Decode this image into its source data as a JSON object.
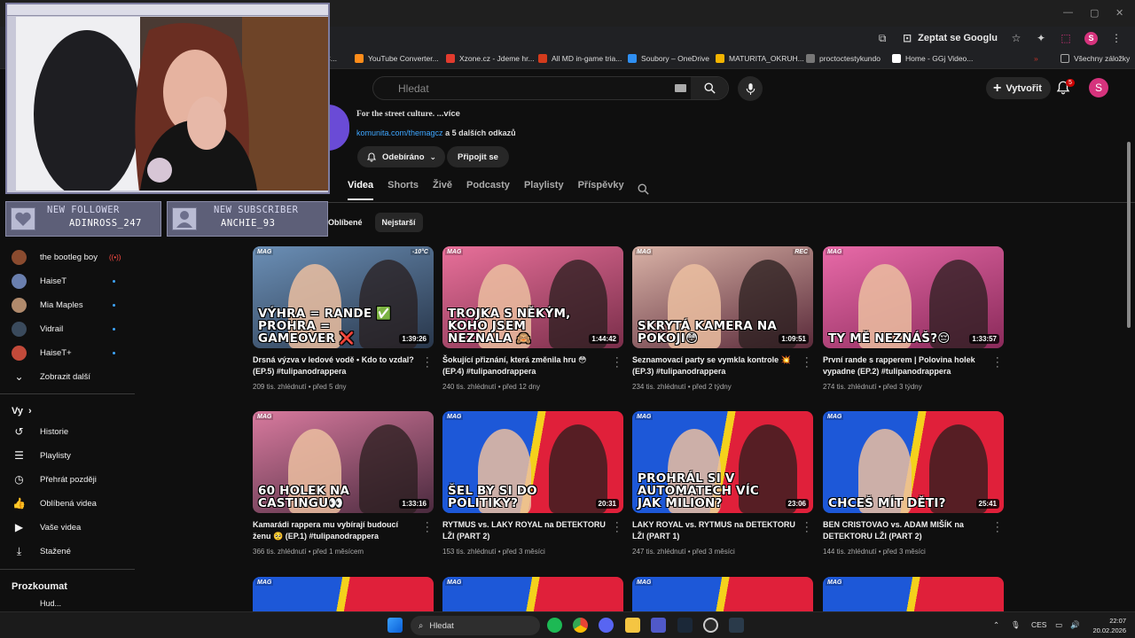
{
  "browser": {
    "ask_google_label": "Zeptat se Googlu",
    "profile_initial": "S",
    "bookmarks": [
      {
        "label": "dC...",
        "color": "#888888"
      },
      {
        "label": "YouTube Converter...",
        "color": "#ff8c1a"
      },
      {
        "label": "Xzone.cz - Jdeme hr...",
        "color": "#e23b2e"
      },
      {
        "label": "All MD in-game tria...",
        "color": "#d33b1c"
      },
      {
        "label": "Soubory – OneDrive",
        "color": "#2f8ff2"
      },
      {
        "label": "MATURITA_OKRUH...",
        "color": "#f4b400"
      },
      {
        "label": "proctoctestykundo",
        "color": "#777777"
      },
      {
        "label": "Home - GGj Video...",
        "color": "#ffffff"
      }
    ],
    "all_bookmarks_label": "Všechny záložky"
  },
  "youtube": {
    "search_placeholder": "Hledat",
    "create_label": "Vytvořit",
    "notification_count": "5",
    "avatar_initial": "S"
  },
  "channel": {
    "description": "For the street culture.",
    "description_more": "...více",
    "link_text": "komunita.com/themagcz",
    "link_suffix": "a 5 dalších odkazů",
    "subscribed_label": "Odebíráno",
    "join_label": "Připojit se",
    "tabs": [
      "Videa",
      "Shorts",
      "Živě",
      "Podcasty",
      "Playlisty",
      "Příspěvky"
    ],
    "chips": [
      "Oblíbené",
      "Nejstarší"
    ]
  },
  "sidebar": {
    "subscriptions": [
      {
        "label": "the bootleg boy",
        "color": "#8a4b2f",
        "live": true
      },
      {
        "label": "HaiseT",
        "color": "#6a7fae",
        "live": false
      },
      {
        "label": "Mia Maples",
        "color": "#b08a6c",
        "live": false
      },
      {
        "label": "Vidrail",
        "color": "#3a4a5c",
        "live": false
      },
      {
        "label": "HaiseT+",
        "color": "#c24a3a",
        "live": false
      }
    ],
    "show_more_label": "Zobrazit další",
    "you_heading": "Vy",
    "you_items": [
      "Historie",
      "Playlisty",
      "Přehrát později",
      "Oblíbená videa",
      "Vaše videa",
      "Stažené"
    ],
    "explore_heading": "Prozkoumat",
    "explore_partial": "Hud..."
  },
  "videos": [
    {
      "caption": "Výhra = rande ✅ Prohra = gameover ❌",
      "duration": "1:39:26",
      "title": "Drsná výzva v ledové vodě • Kdo to vzdal? (EP.5) #tulipanodrappera",
      "meta": "209 tis. zhlédnutí • před 5 dny",
      "c1": "#6b8fb6",
      "c2": "#28364a",
      "tag": "-10°C"
    },
    {
      "caption": "Trojka s někým, koho jsem neznala 🙈",
      "duration": "1:44:42",
      "title": "Šokující přiznání, která změnila hru 😳 (EP.4) #tulipanodrappera",
      "meta": "240 tis. zhlédnutí • před 12 dny",
      "c1": "#e8709a",
      "c2": "#7a2e4a",
      "tag": ""
    },
    {
      "caption": "Skrytá kamera na pokoji😳",
      "duration": "1:09:51",
      "title": "Seznamovací party se vymkla kontrole 💥 (EP.3) #tulipanodrappera",
      "meta": "234 tis. zhlédnutí • před 2 týdny",
      "c1": "#d9b2a6",
      "c2": "#5a2a3a",
      "tag": "REC"
    },
    {
      "caption": "Ty mě neznáš?😔",
      "duration": "1:33:57",
      "title": "První rande s rapperem | Polovina holek vypadne (EP.2) #tulipanodrappera",
      "meta": "274 tis. zhlédnutí • před 3 týdny",
      "c1": "#e86aa8",
      "c2": "#8a2a5a",
      "tag": ""
    },
    {
      "caption": "60 holek na castingu👀",
      "duration": "1:33:16",
      "title": "Kamarádi rappera mu vybírají budoucí ženu 🥺 (EP.1) #tulipanodrappera",
      "meta": "366 tis. zhlédnutí • před 1 měsícem",
      "c1": "#d87a9e",
      "c2": "#4a2a3e",
      "tag": ""
    },
    {
      "caption": "Šel by si do politiky?",
      "duration": "20:31",
      "title": "RYTMUS vs. LAKY ROYAL na DETEKTORU LŽI (PART 2)",
      "meta": "153 tis. zhlédnutí • před 3 měsíci",
      "c1": "#1d58d8",
      "c2": "#e0203a",
      "tag": ""
    },
    {
      "caption": "Prohrál si v automatech víc jak milion?",
      "duration": "23:06",
      "title": "LAKY ROYAL vs. RYTMUS na DETEKTORU LŽI (PART 1)",
      "meta": "247 tis. zhlédnutí • před 3 měsíci",
      "c1": "#1d58d8",
      "c2": "#e0203a",
      "tag": ""
    },
    {
      "caption": "Chceš mít děti?",
      "duration": "25:41",
      "title": "BEN CRISTOVAO vs. ADAM MIŠÍK na DETEKTORU LŽI (PART 2)",
      "meta": "144 tis. zhlédnutí • před 3 měsíci",
      "c1": "#1d58d8",
      "c2": "#e0203a",
      "tag": ""
    }
  ],
  "overlay": {
    "follower_heading": "NEW FOLLOWER",
    "follower_name": "ADINROSS_247",
    "subscriber_heading": "NEW SUBSCRIBER",
    "subscriber_name": "ANCHIE_93"
  },
  "taskbar": {
    "search_label": "Hledat",
    "language": "CES",
    "time": "22:07",
    "date": "20.02.2026"
  }
}
